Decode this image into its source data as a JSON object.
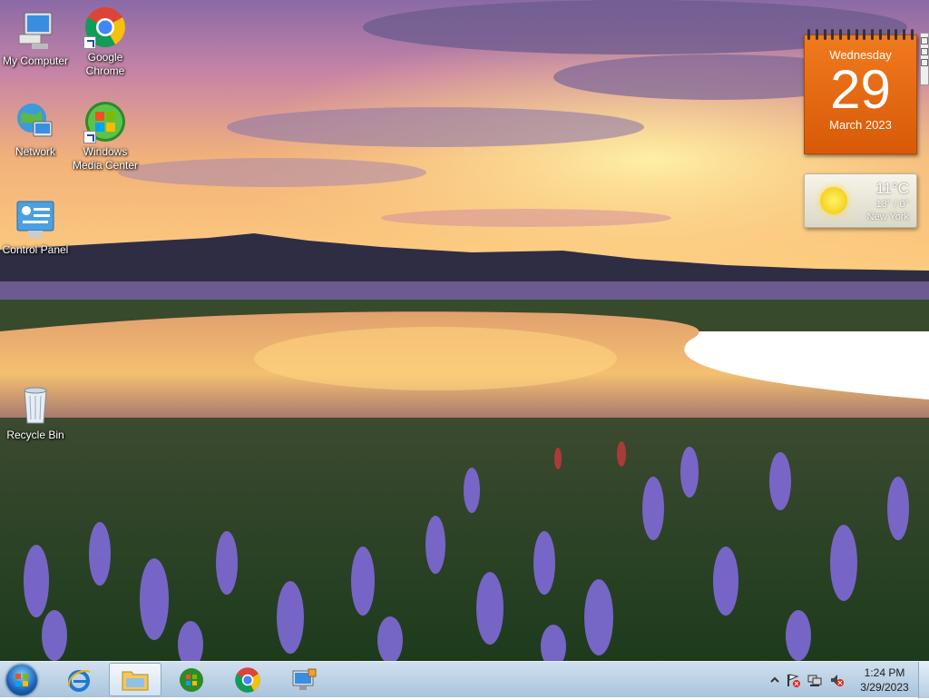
{
  "desktop": {
    "icons": [
      {
        "label": "My Computer",
        "icon": "computer-icon"
      },
      {
        "label": "Google\nChrome",
        "icon": "chrome-icon"
      },
      {
        "label": "Network",
        "icon": "network-icon"
      },
      {
        "label": "Windows\nMedia Center",
        "icon": "media-center-icon"
      },
      {
        "label": "Control Panel",
        "icon": "control-panel-icon"
      },
      {
        "label": "Recycle Bin",
        "icon": "recycle-bin-icon"
      }
    ]
  },
  "gadgets": {
    "calendar": {
      "weekday": "Wednesday",
      "day": "29",
      "month_year": "March 2023"
    },
    "weather": {
      "temperature": "11°C",
      "high_low": "13° / 0°",
      "city": "New York",
      "condition_icon": "sun-icon"
    }
  },
  "taskbar": {
    "pinned": [
      "internet-explorer-icon",
      "file-explorer-icon",
      "windows-media-player-icon",
      "chrome-icon",
      "remote-desktop-icon"
    ],
    "clock": {
      "time": "1:24 PM",
      "date": "3/29/2023"
    },
    "tray_icons": [
      "show-hidden-icons-arrow",
      "action-center-flag-icon",
      "network-icon",
      "volume-muted-icon"
    ]
  },
  "colors": {
    "calendar_orange": "#e86a12",
    "taskbar": "#bcd3e8"
  }
}
